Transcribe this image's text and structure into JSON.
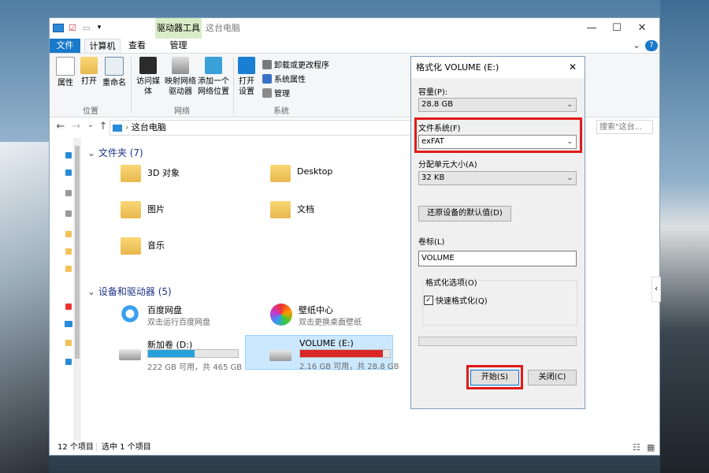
{
  "window": {
    "ribbon_context_tab": "驱动器工具",
    "title": "这台电脑",
    "controls": {
      "minimize": "—",
      "maximize": "☐",
      "close": "✕",
      "help": "?",
      "collapse": "⌄"
    },
    "tabs": [
      "文件",
      "计算机",
      "查看",
      "管理"
    ]
  },
  "ribbon": {
    "groups": [
      {
        "name": "位置",
        "buttons": [
          "属性",
          "打开",
          "重命名"
        ]
      },
      {
        "name": "网络",
        "buttons": [
          "访问媒体",
          "映射网络驱动器",
          "添加一个网络位置"
        ]
      },
      {
        "name": "系统",
        "buttons": [
          "打开设置"
        ],
        "small": [
          "卸载或更改程序",
          "系统属性",
          "管理"
        ]
      }
    ]
  },
  "address": {
    "path": "这台电脑",
    "search_placeholder": "搜索\"这台...",
    "arrows": [
      "←",
      "→",
      "⌄",
      "↑"
    ]
  },
  "content": {
    "folders_header": "文件夹 (7)",
    "folders": [
      "3D 对象",
      "Desktop",
      "图片",
      "文档",
      "音乐"
    ],
    "devices_header": "设备和驱动器 (5)",
    "apps": [
      {
        "name": "百度网盘",
        "sub": "双击运行百度网盘"
      },
      {
        "name": "壁纸中心",
        "sub": "双击更换桌面壁纸"
      }
    ],
    "drives": [
      {
        "name": "新加卷 (D:)",
        "info": "222 GB 可用，共 465 GB",
        "used_pct": 52,
        "color": "#26a0da"
      },
      {
        "name": "VOLUME (E:)",
        "info": "2.16 GB 可用，共 28.8 GB",
        "used_pct": 92,
        "color": "#da2626"
      }
    ]
  },
  "status": {
    "items": "12 个项目",
    "selected": "选中 1 个项目"
  },
  "dialog": {
    "title": "格式化 VOLUME (E:)",
    "capacity_label": "容量(P):",
    "capacity_value": "28.8 GB",
    "fs_label": "文件系统(F)",
    "fs_value": "exFAT",
    "alloc_label": "分配单元大小(A)",
    "alloc_value": "32 KB",
    "restore_button": "还原设备的默认值(D)",
    "volume_label": "卷标(L)",
    "volume_value": "VOLUME",
    "options_label": "格式化选项(O)",
    "quick_format": "快速格式化(Q)",
    "start_button": "开始(S)",
    "close_button": "关闭(C)"
  }
}
